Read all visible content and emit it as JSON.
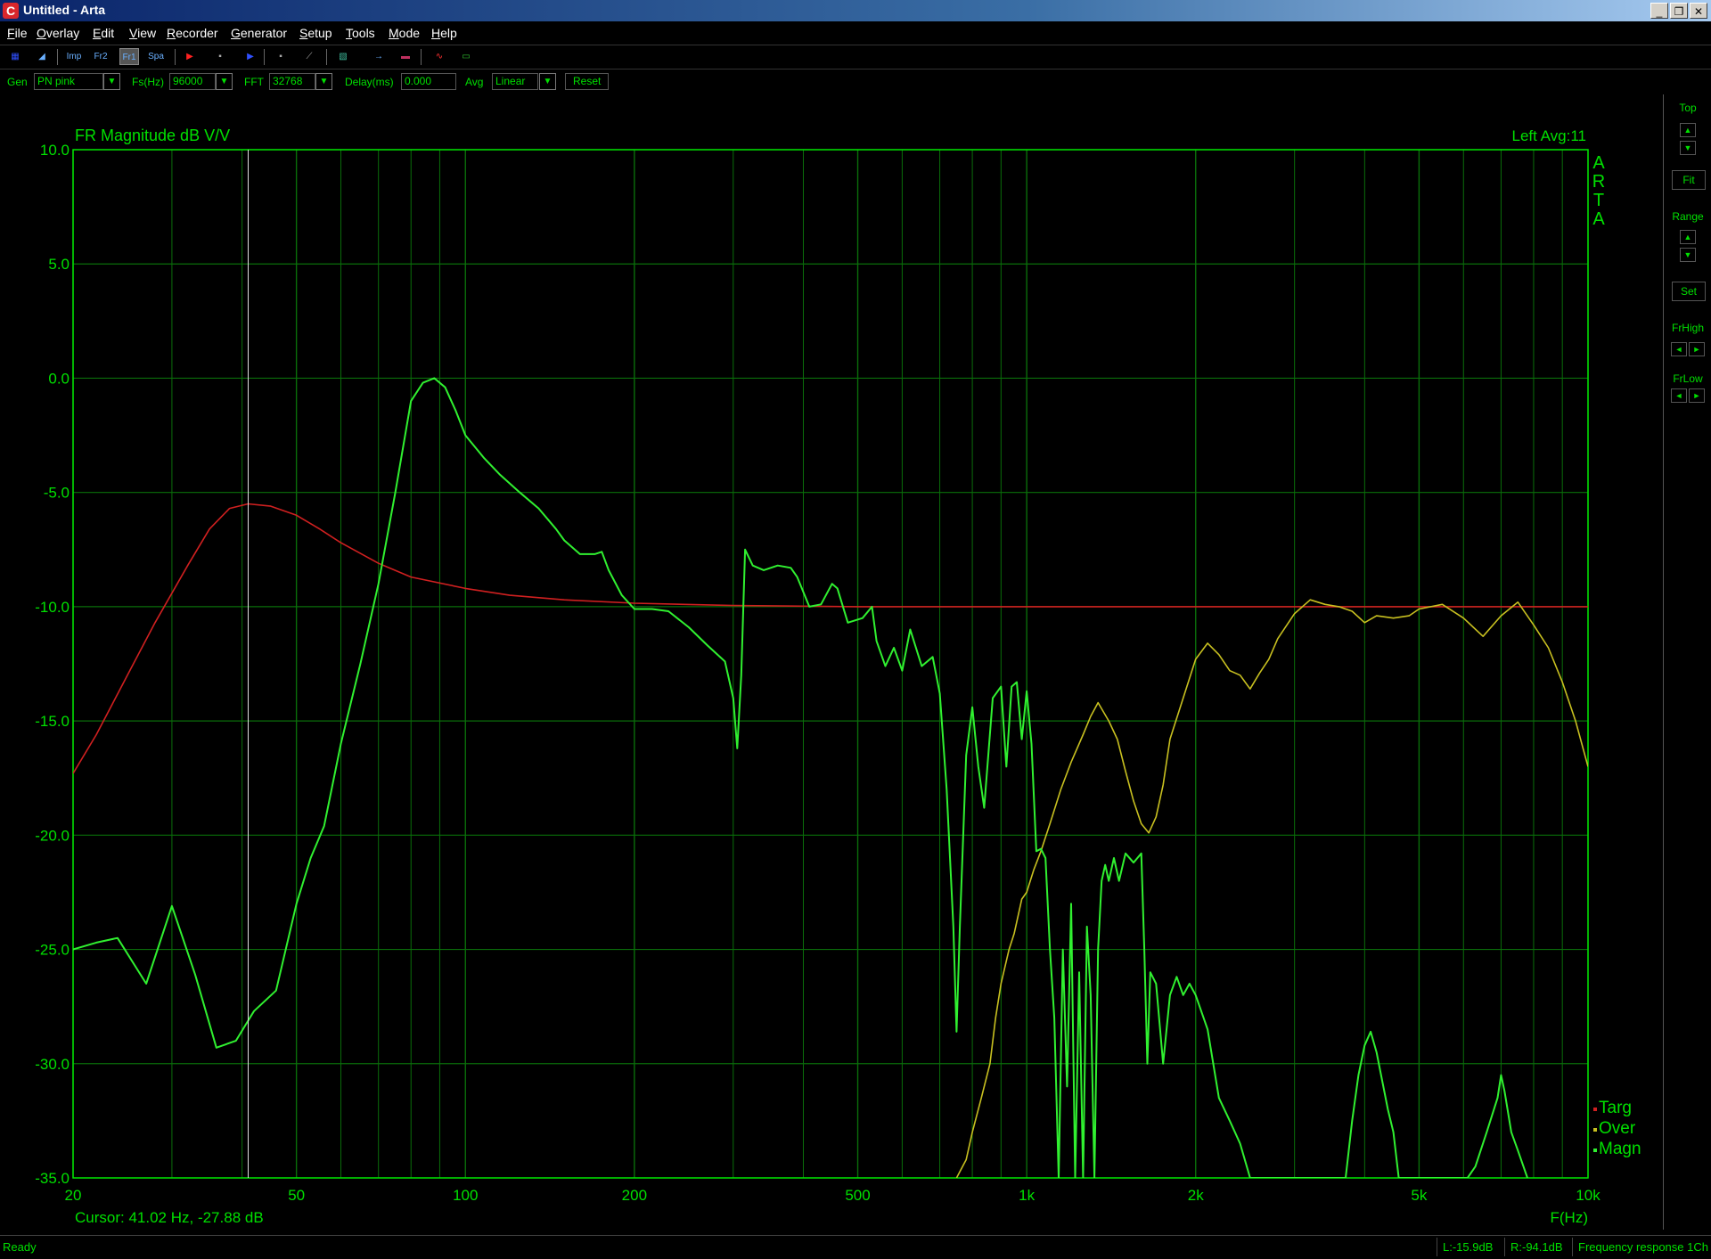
{
  "window": {
    "app_icon": "C",
    "title": "Untitled - Arta",
    "minimize_label": "_",
    "restore_label": "❐",
    "close_label": "✕"
  },
  "menu": [
    "File",
    "Overlay",
    "Edit",
    "View",
    "Recorder",
    "Generator",
    "Setup",
    "Tools",
    "Mode",
    "Help"
  ],
  "toolbar": {
    "buttons": [
      {
        "name": "toolbar-grid-icon",
        "glyph": "▦",
        "color": "#3050ff"
      },
      {
        "name": "toolbar-triangle-icon",
        "glyph": "◢",
        "color": "#6ab0ff"
      },
      {
        "name": "toolbar-imp-mode-icon",
        "glyph": "Imp",
        "color": "#6ab0ff"
      },
      {
        "name": "toolbar-fr2-mode-icon",
        "glyph": "Fr2",
        "color": "#6ab0ff"
      },
      {
        "name": "toolbar-fr1-mode-icon",
        "glyph": "Fr1",
        "color": "#6ab0ff",
        "pressed": true
      },
      {
        "name": "toolbar-spa-mode-icon",
        "glyph": "Spa",
        "color": "#6ab0ff"
      },
      {
        "name": "toolbar-record-play-icon",
        "glyph": "▶",
        "color": "#ff2020"
      },
      {
        "name": "toolbar-stop-record-icon",
        "glyph": "▪",
        "color": "#aaaaaa"
      },
      {
        "name": "toolbar-play-icon",
        "glyph": "▶",
        "color": "#3050ff"
      },
      {
        "name": "toolbar-stop-icon",
        "glyph": "▪",
        "color": "#aaaaaa"
      },
      {
        "name": "toolbar-ramp-icon",
        "glyph": "⟋",
        "color": "#aaaaaa"
      },
      {
        "name": "toolbar-hatch-icon",
        "glyph": "▧",
        "color": "#40c0a0"
      },
      {
        "name": "toolbar-arrow-right-icon",
        "glyph": "→",
        "color": "#6ab0ff"
      },
      {
        "name": "toolbar-overlay-icon",
        "glyph": "▬",
        "color": "#c03060"
      },
      {
        "name": "toolbar-wave-icon",
        "glyph": "∿",
        "color": "#ff3030"
      },
      {
        "name": "toolbar-overlay-green-icon",
        "glyph": "▭",
        "color": "#30c030"
      }
    ]
  },
  "params": {
    "gen_label": "Gen",
    "gen_value": "PN pink",
    "fs_label": "Fs(Hz)",
    "fs_value": "96000",
    "fft_label": "FFT",
    "fft_value": "32768",
    "delay_label": "Delay(ms)",
    "delay_value": "0.000",
    "avg_label": "Avg",
    "avg_value": "Linear",
    "reset_label": "Reset",
    "dropdown_glyph": "▼"
  },
  "right_panel": {
    "top_label": "Top",
    "fit_label": "Fit",
    "range_label": "Range",
    "set_label": "Set",
    "frhigh_label": "FrHigh",
    "frlow_label": "FrLow",
    "up_glyph": "▲",
    "down_glyph": "▼",
    "left_glyph": "◄",
    "right_glyph": "►"
  },
  "status": {
    "ready": "Ready",
    "left_level": "L:-15.9dB",
    "right_level": "R:-94.1dB",
    "mode": "Frequency response 1Ch"
  },
  "chart_data": {
    "type": "line",
    "title": "FR Magnitude dB V/V",
    "channel_info": "Left  Avg:11",
    "watermark": [
      "A",
      "R",
      "T",
      "A"
    ],
    "cursor_text": "Cursor: 41.02 Hz, -27.88 dB",
    "cursor_freq": 41.02,
    "xlabel": "F(Hz)",
    "xscale": "log",
    "xlim": [
      20,
      10000
    ],
    "ylim": [
      -35,
      10
    ],
    "y_ticks": [
      10,
      5,
      0,
      -5,
      -10,
      -15,
      -20,
      -25,
      -30,
      -35
    ],
    "y_tick_labels": [
      "10.0",
      "5.0",
      "0.0",
      "-5.0",
      "-10.0",
      "-15.0",
      "-20.0",
      "-25.0",
      "-30.0",
      "-35.0"
    ],
    "x_major_ticks": [
      20,
      50,
      100,
      200,
      500,
      1000,
      2000,
      5000,
      10000
    ],
    "x_tick_labels": [
      "20",
      "50",
      "100",
      "200",
      "500",
      "1k",
      "2k",
      "5k",
      "10k"
    ],
    "x_minor_ticks": [
      30,
      40,
      60,
      70,
      80,
      90,
      300,
      400,
      600,
      700,
      800,
      900,
      3000,
      4000,
      6000,
      7000,
      8000,
      9000
    ],
    "grid": true,
    "colors": {
      "axis": "#00e000",
      "grid": "#0a6e0a",
      "targ": "#d02020",
      "over": "#c8c020",
      "magn": "#30f030",
      "cursor": "#e0e0e0"
    },
    "legend": [
      "Targ",
      "Over",
      "Magn"
    ],
    "legend_position": "bottom-right",
    "series": [
      {
        "name": "Targ",
        "color": "#d02020",
        "points": [
          [
            20,
            -17.3
          ],
          [
            22,
            -15.6
          ],
          [
            25,
            -13
          ],
          [
            28,
            -10.7
          ],
          [
            32,
            -8.2
          ],
          [
            35,
            -6.6
          ],
          [
            38,
            -5.7
          ],
          [
            41,
            -5.5
          ],
          [
            45,
            -5.6
          ],
          [
            50,
            -6.0
          ],
          [
            55,
            -6.6
          ],
          [
            60,
            -7.2
          ],
          [
            70,
            -8.1
          ],
          [
            80,
            -8.7
          ],
          [
            100,
            -9.2
          ],
          [
            120,
            -9.5
          ],
          [
            150,
            -9.7
          ],
          [
            200,
            -9.85
          ],
          [
            300,
            -9.95
          ],
          [
            500,
            -10
          ],
          [
            1000,
            -10
          ],
          [
            2000,
            -10
          ],
          [
            5000,
            -10
          ],
          [
            10000,
            -10
          ]
        ]
      },
      {
        "name": "Over",
        "color": "#c8c020",
        "points": [
          [
            750,
            -35
          ],
          [
            780,
            -34.2
          ],
          [
            800,
            -33
          ],
          [
            830,
            -31.5
          ],
          [
            860,
            -30
          ],
          [
            880,
            -28
          ],
          [
            900,
            -26.5
          ],
          [
            930,
            -25
          ],
          [
            950,
            -24.3
          ],
          [
            980,
            -22.8
          ],
          [
            1000,
            -22.5
          ],
          [
            1030,
            -21.5
          ],
          [
            1060,
            -20.7
          ],
          [
            1100,
            -19.5
          ],
          [
            1150,
            -18
          ],
          [
            1200,
            -16.8
          ],
          [
            1260,
            -15.6
          ],
          [
            1300,
            -14.8
          ],
          [
            1340,
            -14.2
          ],
          [
            1400,
            -15
          ],
          [
            1450,
            -15.8
          ],
          [
            1500,
            -17.2
          ],
          [
            1550,
            -18.5
          ],
          [
            1600,
            -19.5
          ],
          [
            1650,
            -19.9
          ],
          [
            1700,
            -19.2
          ],
          [
            1750,
            -17.8
          ],
          [
            1800,
            -15.8
          ],
          [
            1900,
            -14
          ],
          [
            2000,
            -12.3
          ],
          [
            2100,
            -11.6
          ],
          [
            2200,
            -12.1
          ],
          [
            2300,
            -12.8
          ],
          [
            2400,
            -13
          ],
          [
            2500,
            -13.6
          ],
          [
            2600,
            -12.9
          ],
          [
            2700,
            -12.3
          ],
          [
            2800,
            -11.4
          ],
          [
            3000,
            -10.3
          ],
          [
            3200,
            -9.7
          ],
          [
            3400,
            -9.9
          ],
          [
            3600,
            -10
          ],
          [
            3800,
            -10.2
          ],
          [
            4000,
            -10.7
          ],
          [
            4200,
            -10.4
          ],
          [
            4500,
            -10.5
          ],
          [
            4800,
            -10.4
          ],
          [
            5000,
            -10.1
          ],
          [
            5500,
            -9.9
          ],
          [
            6000,
            -10.5
          ],
          [
            6500,
            -11.3
          ],
          [
            7000,
            -10.4
          ],
          [
            7500,
            -9.8
          ],
          [
            8000,
            -10.8
          ],
          [
            8500,
            -11.8
          ],
          [
            9000,
            -13.3
          ],
          [
            9500,
            -15
          ],
          [
            10000,
            -17
          ]
        ]
      },
      {
        "name": "Magn",
        "color": "#30f030",
        "points": [
          [
            20,
            -25
          ],
          [
            22,
            -24.7
          ],
          [
            24,
            -24.5
          ],
          [
            27,
            -26.5
          ],
          [
            30,
            -23.1
          ],
          [
            33,
            -26.1
          ],
          [
            36,
            -29.3
          ],
          [
            39,
            -29
          ],
          [
            42,
            -27.7
          ],
          [
            46,
            -26.8
          ],
          [
            50,
            -23
          ],
          [
            53,
            -21
          ],
          [
            56,
            -19.6
          ],
          [
            60,
            -16
          ],
          [
            65,
            -12.5
          ],
          [
            70,
            -9
          ],
          [
            75,
            -5
          ],
          [
            80,
            -1
          ],
          [
            84,
            -0.2
          ],
          [
            88,
            0
          ],
          [
            92,
            -0.4
          ],
          [
            96,
            -1.4
          ],
          [
            100,
            -2.5
          ],
          [
            108,
            -3.5
          ],
          [
            115,
            -4.2
          ],
          [
            125,
            -5
          ],
          [
            135,
            -5.7
          ],
          [
            145,
            -6.6
          ],
          [
            150,
            -7.1
          ],
          [
            160,
            -7.7
          ],
          [
            170,
            -7.7
          ],
          [
            175,
            -7.6
          ],
          [
            180,
            -8.4
          ],
          [
            190,
            -9.5
          ],
          [
            200,
            -10.1
          ],
          [
            215,
            -10.1
          ],
          [
            230,
            -10.2
          ],
          [
            250,
            -10.9
          ],
          [
            270,
            -11.7
          ],
          [
            290,
            -12.4
          ],
          [
            300,
            -14
          ],
          [
            305,
            -16.2
          ],
          [
            310,
            -13
          ],
          [
            315,
            -7.5
          ],
          [
            325,
            -8.2
          ],
          [
            340,
            -8.4
          ],
          [
            360,
            -8.2
          ],
          [
            380,
            -8.3
          ],
          [
            390,
            -8.7
          ],
          [
            410,
            -10
          ],
          [
            430,
            -9.9
          ],
          [
            450,
            -9
          ],
          [
            460,
            -9.2
          ],
          [
            480,
            -10.7
          ],
          [
            510,
            -10.5
          ],
          [
            530,
            -10
          ],
          [
            540,
            -11.5
          ],
          [
            560,
            -12.6
          ],
          [
            580,
            -11.8
          ],
          [
            600,
            -12.8
          ],
          [
            620,
            -11
          ],
          [
            650,
            -12.6
          ],
          [
            680,
            -12.2
          ],
          [
            700,
            -13.8
          ],
          [
            720,
            -18
          ],
          [
            740,
            -24
          ],
          [
            750,
            -28.6
          ],
          [
            760,
            -24
          ],
          [
            780,
            -16.5
          ],
          [
            800,
            -14.4
          ],
          [
            820,
            -17
          ],
          [
            840,
            -18.8
          ],
          [
            870,
            -14
          ],
          [
            900,
            -13.5
          ],
          [
            920,
            -17
          ],
          [
            940,
            -13.5
          ],
          [
            960,
            -13.3
          ],
          [
            980,
            -15.8
          ],
          [
            1000,
            -13.7
          ],
          [
            1020,
            -16
          ],
          [
            1040,
            -20.7
          ],
          [
            1060,
            -20.6
          ],
          [
            1080,
            -21
          ],
          [
            1100,
            -25
          ],
          [
            1120,
            -28
          ],
          [
            1140,
            -35
          ],
          [
            1160,
            -25
          ],
          [
            1180,
            -31
          ],
          [
            1200,
            -23
          ],
          [
            1220,
            -35
          ],
          [
            1240,
            -26
          ],
          [
            1260,
            -35
          ],
          [
            1280,
            -24
          ],
          [
            1300,
            -27
          ],
          [
            1320,
            -35
          ],
          [
            1340,
            -25
          ],
          [
            1360,
            -22
          ],
          [
            1380,
            -21.3
          ],
          [
            1400,
            -22
          ],
          [
            1430,
            -21
          ],
          [
            1460,
            -22
          ],
          [
            1500,
            -20.8
          ],
          [
            1550,
            -21.2
          ],
          [
            1600,
            -20.8
          ],
          [
            1620,
            -25
          ],
          [
            1640,
            -30
          ],
          [
            1660,
            -26
          ],
          [
            1700,
            -26.5
          ],
          [
            1750,
            -30
          ],
          [
            1800,
            -27
          ],
          [
            1850,
            -26.2
          ],
          [
            1900,
            -27
          ],
          [
            1950,
            -26.5
          ],
          [
            2000,
            -27
          ],
          [
            2100,
            -28.5
          ],
          [
            2200,
            -31.5
          ],
          [
            2300,
            -32.5
          ],
          [
            2400,
            -33.5
          ],
          [
            2500,
            -35
          ],
          [
            3700,
            -35
          ],
          [
            3800,
            -32.5
          ],
          [
            3900,
            -30.5
          ],
          [
            4000,
            -29.2
          ],
          [
            4100,
            -28.6
          ],
          [
            4200,
            -29.5
          ],
          [
            4400,
            -32
          ],
          [
            4500,
            -33
          ],
          [
            4600,
            -35
          ],
          [
            6100,
            -35
          ],
          [
            6300,
            -34.5
          ],
          [
            6600,
            -33
          ],
          [
            6900,
            -31.5
          ],
          [
            7000,
            -30.5
          ],
          [
            7100,
            -31.2
          ],
          [
            7300,
            -33
          ],
          [
            7500,
            -33.8
          ],
          [
            7800,
            -35
          ]
        ]
      }
    ]
  }
}
